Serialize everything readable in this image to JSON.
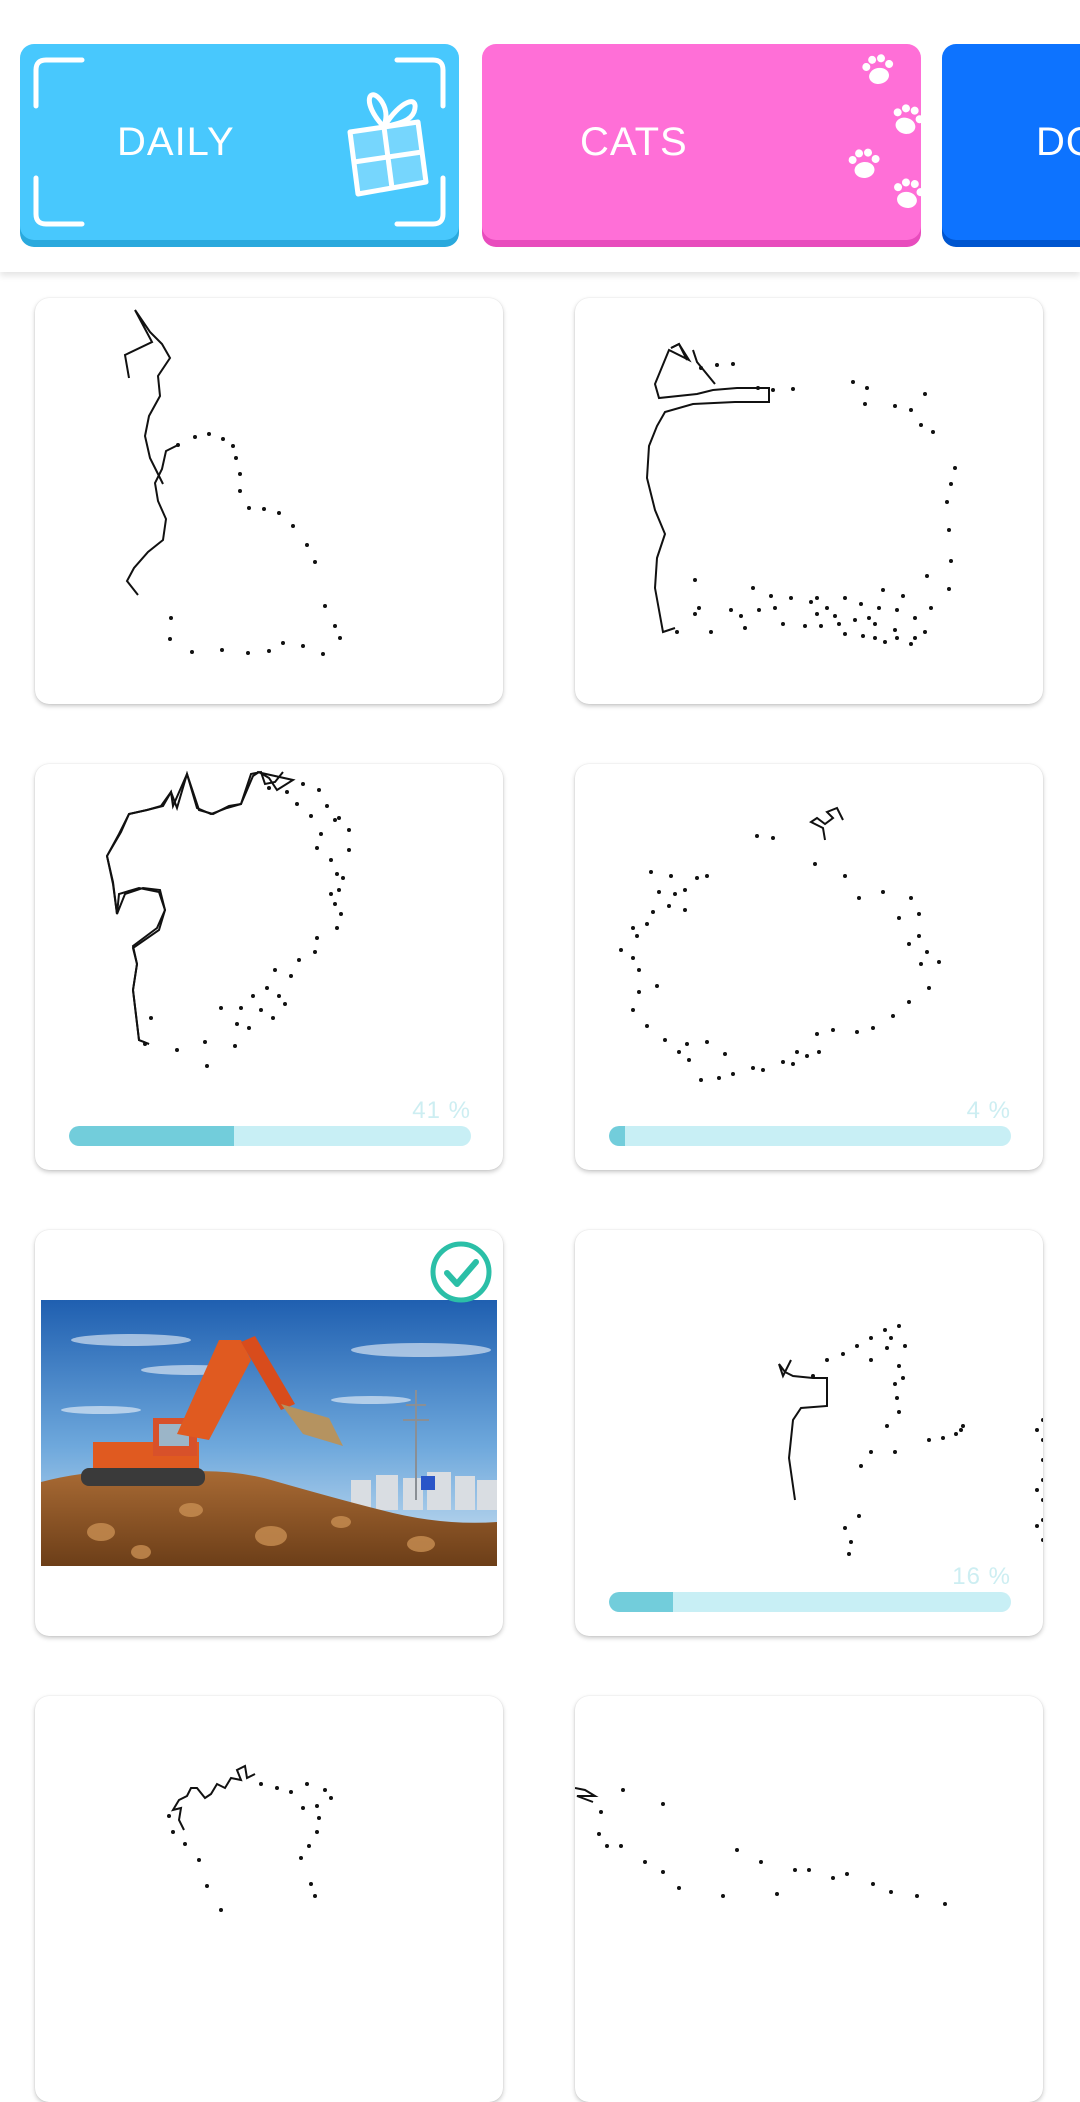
{
  "categories": [
    {
      "label": "DAILY",
      "icon": "gift-icon",
      "color": "#48c8fd"
    },
    {
      "label": "CATS",
      "icon": "paw-icon",
      "color": "#ff6fd7"
    },
    {
      "label": "DOGS",
      "icon": "",
      "color": "#0d73ff"
    }
  ],
  "puzzles": [
    {
      "subject": "rabbit",
      "progress": 0
    },
    {
      "subject": "apple",
      "progress": 0
    },
    {
      "subject": "dragon",
      "progress": 41,
      "progress_label": "41 %"
    },
    {
      "subject": "apple-outline",
      "progress": 4,
      "progress_label": "4 %"
    },
    {
      "subject": "excavator",
      "completed": true,
      "icon": "checkmark-circle-icon"
    },
    {
      "subject": "animal",
      "progress": 16,
      "progress_label": "16 %"
    },
    {
      "subject": "flower",
      "progress": 0
    },
    {
      "subject": "bird",
      "progress": 0
    }
  ],
  "colors": {
    "progress_fill": "#72cddb",
    "progress_track": "#c8eff5",
    "check": "#2bbfa7"
  }
}
